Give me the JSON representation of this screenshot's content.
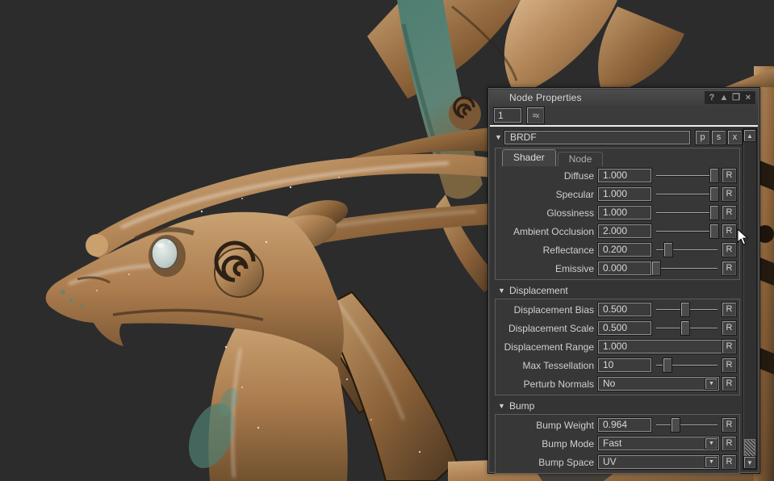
{
  "window": {
    "title": "Node Properties",
    "icons": {
      "help": "?",
      "shade": "▲",
      "restore": "❐",
      "close": "×"
    },
    "selection_value": "1",
    "filter_icon_glyph": "≡x"
  },
  "brdf_header": {
    "collapse_glyph": "▼",
    "name": "BRDF",
    "btn_p": "p",
    "btn_s": "s",
    "btn_x": "x"
  },
  "tabs": [
    {
      "label": "Shader"
    },
    {
      "label": "Node"
    }
  ],
  "reset_label": "R",
  "dropdown_glyph": "▼",
  "scrollbar": {
    "up_glyph": "▲",
    "down_glyph": "▼"
  },
  "sections": [
    {
      "collapse_glyph": "▼",
      "label": "Displacement"
    },
    {
      "collapse_glyph": "▼",
      "label": "Bump"
    }
  ],
  "rows": [
    {
      "label": "Diffuse",
      "value": "1.000",
      "type": "slider",
      "pct": "93%"
    },
    {
      "label": "Specular",
      "value": "1.000",
      "type": "slider",
      "pct": "93%"
    },
    {
      "label": "Glossiness",
      "value": "1.000",
      "type": "slider",
      "pct": "93%"
    },
    {
      "label": "Ambient Occlusion",
      "value": "2.000",
      "type": "slider",
      "pct": "93%"
    },
    {
      "label": "Reflectance",
      "value": "0.200",
      "type": "slider",
      "pct": "21%"
    },
    {
      "label": "Emissive",
      "value": "0.000",
      "type": "slider",
      "pct": "3%"
    },
    {
      "label": "Displacement Bias",
      "value": "0.500",
      "type": "slider",
      "pct": "48%"
    },
    {
      "label": "Displacement Scale",
      "value": "0.500",
      "type": "slider",
      "pct": "48%"
    },
    {
      "label": "Displacement Range",
      "value": "1.000",
      "type": "wide"
    },
    {
      "label": "Max Tessellation",
      "value": "10",
      "type": "slider",
      "pct": "20%"
    },
    {
      "label": "Perturb Normals",
      "value": "No",
      "type": "dropdown"
    },
    {
      "label": "Bump Weight",
      "value": "0.964",
      "type": "slider",
      "pct": "32%"
    },
    {
      "label": "Bump Mode",
      "value": "Fast",
      "type": "dropdown"
    },
    {
      "label": "Bump Space",
      "value": "UV",
      "type": "dropdown"
    }
  ],
  "colors": {
    "viewport_bg": "#2c2c2c",
    "panel_bg": "#3b3b3b",
    "bronze_light": "#d8b58a",
    "bronze_mid": "#a97a4e",
    "bronze_dark": "#5a4228",
    "patina_teal": "#4e7f72",
    "eye_pale": "#c8d2cf"
  }
}
